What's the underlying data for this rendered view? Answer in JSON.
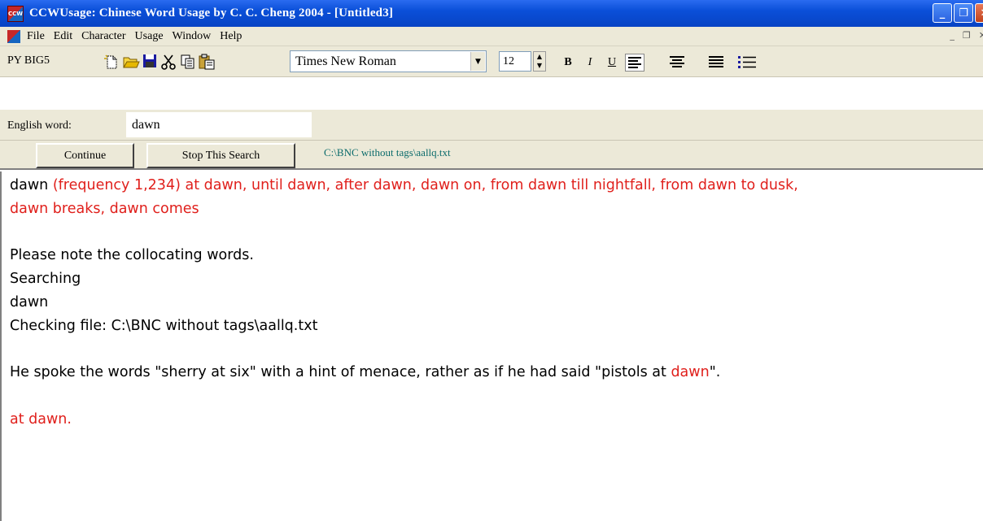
{
  "window": {
    "app_icon": "CCW",
    "title": "CCWUsage: Chinese Word Usage  by C. C. Cheng 2004 - [Untitled3]",
    "buttons": {
      "minimize": "_",
      "restore": "❐",
      "close": "✕"
    }
  },
  "menubar": {
    "items": [
      "File",
      "Edit",
      "Character",
      "Usage",
      "Window",
      "Help"
    ],
    "mdi_buttons": {
      "minimize": "_",
      "restore": "❐",
      "close": "✕"
    }
  },
  "toolbar": {
    "mode_label": "PY BIG5",
    "icons": [
      "new-document-icon",
      "open-folder-icon",
      "save-disk-icon",
      "cut-scissors-icon",
      "copy-icon",
      "paste-icon"
    ],
    "font_name": "Times New Roman",
    "font_size": "12",
    "bold": "B",
    "italic": "I",
    "underline": "U"
  },
  "search": {
    "label": "English word:",
    "value": "dawn"
  },
  "actions": {
    "continue_label": "Continue",
    "stop_label": "Stop This Search",
    "file_path": "C:\\BNC without tags\\aallq.txt"
  },
  "colors": {
    "highlight": "#e0201c",
    "path_text": "#0b6b6b"
  },
  "content": {
    "line1_word": "dawn",
    "line1_rest": " (frequency 1,234) at dawn, until dawn, after dawn, dawn on, from dawn till nightfall, from dawn to dusk,",
    "line2": "dawn breaks, dawn comes",
    "note": "Please note the collocating words.",
    "searching": "Searching",
    "search_word": "dawn",
    "checking": "Checking file: C:\\BNC without tags\\aallq.txt",
    "sentence_before": "He spoke the words \"sherry at six\" with a hint of menace, rather as if he had said \"pistols at ",
    "sentence_hit": "dawn",
    "sentence_after": "\".",
    "result": "at dawn."
  }
}
